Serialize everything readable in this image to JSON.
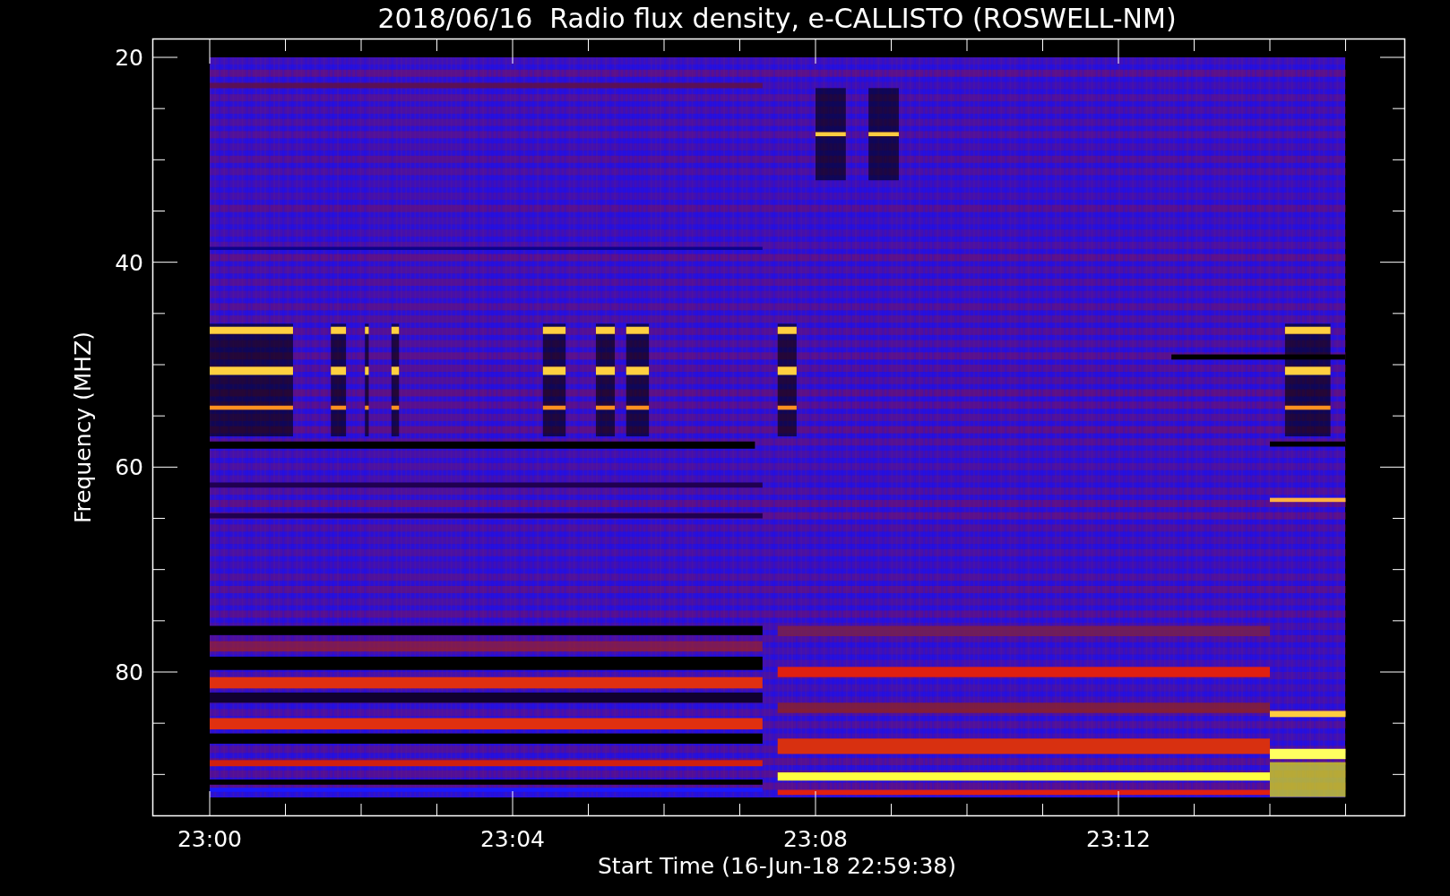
{
  "title": "2018/06/16  Radio flux density, e-CALLISTO (ROSWELL-NM)",
  "y_axis": {
    "label": "Frequency (MHZ)",
    "ticks": [
      "20",
      "40",
      "60",
      "80"
    ]
  },
  "x_axis": {
    "label": "Start Time (16-Jun-18 22:59:38)",
    "ticks": [
      "23:00",
      "23:04",
      "23:08",
      "23:12"
    ]
  }
}
